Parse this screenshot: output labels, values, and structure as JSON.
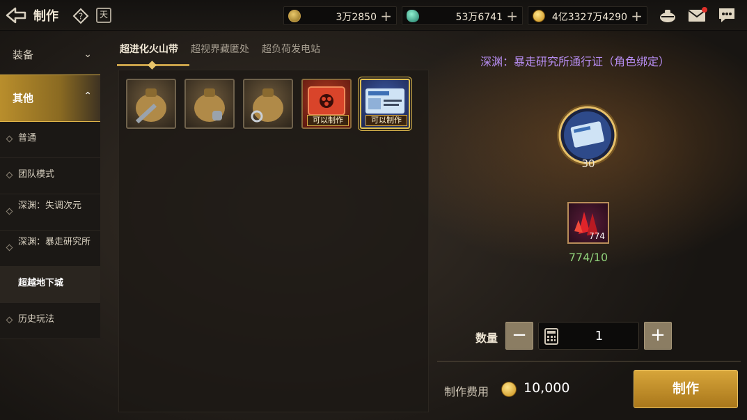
{
  "header": {
    "title": "制作",
    "calendar_char": "天",
    "currencies": [
      {
        "icon": "gold-token-icon",
        "value": "3万2850"
      },
      {
        "icon": "teal-crystal-icon",
        "value": "53万6741"
      },
      {
        "icon": "gold-coin-icon",
        "value": "4亿3327万4290"
      }
    ],
    "plus": "+",
    "icons": [
      "pot-icon",
      "mail-icon",
      "chat-icon"
    ]
  },
  "sidebar": {
    "categories": [
      {
        "label": "装备",
        "chevron": "⌄"
      },
      {
        "label": "其他",
        "chevron": "⌃"
      }
    ],
    "items": [
      {
        "label": "普通"
      },
      {
        "label": "团队模式"
      },
      {
        "label": "深渊：失调次元"
      },
      {
        "label": "深渊：暴走研究所"
      },
      {
        "label": "超越地下城"
      },
      {
        "label": "历史玩法"
      }
    ]
  },
  "tabs": [
    {
      "label": "超进化火山带"
    },
    {
      "label": "超视界藏匿处"
    },
    {
      "label": "超负荷发电站"
    }
  ],
  "grid": {
    "slots": [
      {
        "type": "pouch-sword",
        "badge": ""
      },
      {
        "type": "pouch-gauntlet",
        "badge": ""
      },
      {
        "type": "pouch-ring",
        "badge": ""
      },
      {
        "type": "red-ticket",
        "badge": "可以制作"
      },
      {
        "type": "blue-pass",
        "badge": "可以制作"
      }
    ]
  },
  "detail": {
    "title": "深渊：暴走研究所通行证（角色绑定）",
    "result_count": "30",
    "material_qty": "774",
    "material_progress": "774/10",
    "quantity_label": "数量",
    "minus": "−",
    "plus": "+",
    "quantity": "1",
    "cost_label": "制作费用",
    "cost_value": "10,000",
    "craft_label": "制作"
  },
  "colors": {
    "accent_gold": "#c9a24a",
    "title_purple": "#b68cf0",
    "progress_green": "#8fd07a"
  }
}
